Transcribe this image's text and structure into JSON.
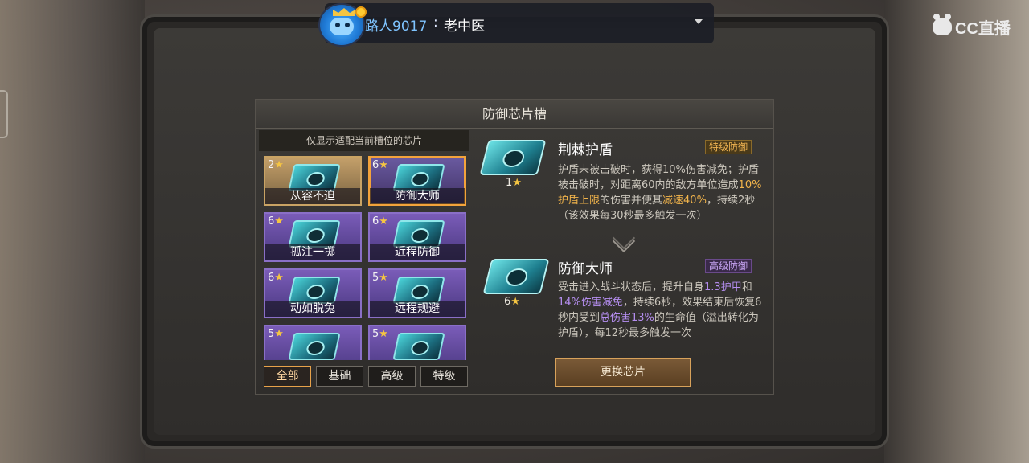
{
  "stream": {
    "user": "路人9017",
    "separator": ":",
    "title": "老中医"
  },
  "logo": {
    "text": "CC直播"
  },
  "dialog": {
    "title": "防御芯片槽",
    "filter_note": "仅显示适配当前槽位的芯片",
    "cards": [
      {
        "stars": "2",
        "name": "从容不迫",
        "rarity": "gold"
      },
      {
        "stars": "6",
        "name": "防御大师",
        "rarity": "purple",
        "selected": true
      },
      {
        "stars": "6",
        "name": "孤注一掷",
        "rarity": "purple"
      },
      {
        "stars": "6",
        "name": "近程防御",
        "rarity": "purple"
      },
      {
        "stars": "6",
        "name": "动如脱兔",
        "rarity": "purple"
      },
      {
        "stars": "5",
        "name": "远程规避",
        "rarity": "purple"
      },
      {
        "stars": "5",
        "name": "",
        "rarity": "purple"
      },
      {
        "stars": "5",
        "name": "",
        "rarity": "purple"
      }
    ],
    "star_glyph": "★",
    "tabs": [
      {
        "label": "全部",
        "active": true
      },
      {
        "label": "基础",
        "active": false
      },
      {
        "label": "高级",
        "active": false
      },
      {
        "label": "特级",
        "active": false
      }
    ],
    "current": {
      "stars": "1",
      "title": "荆棘护盾",
      "grade": "特级防御",
      "desc_parts": [
        {
          "t": "护盾未被击破时，获得10%伤害减免；护盾被击破时，对距离60内的敌方单位造成",
          "c": ""
        },
        {
          "t": "10%护盾上限",
          "c": "gold"
        },
        {
          "t": "的伤害并使其",
          "c": ""
        },
        {
          "t": "减速40%",
          "c": "gold"
        },
        {
          "t": "，持续2秒（该效果每30秒最多触发一次）",
          "c": ""
        }
      ]
    },
    "next": {
      "stars": "6",
      "title": "防御大师",
      "grade": "高级防御",
      "desc_parts": [
        {
          "t": "受击进入战斗状态后，提升自身",
          "c": ""
        },
        {
          "t": "1.3护甲",
          "c": "purple"
        },
        {
          "t": "和",
          "c": ""
        },
        {
          "t": "14%伤害减免",
          "c": "purple"
        },
        {
          "t": "，持续6秒，效果结束后恢复6秒内受到",
          "c": ""
        },
        {
          "t": "总伤害13%",
          "c": "purple"
        },
        {
          "t": "的生命值（溢出转化为护盾），每12秒最多触发一次",
          "c": ""
        }
      ]
    },
    "replace_button": "更换芯片"
  },
  "colors": {
    "gold_accent": "#f2b44b",
    "purple_accent": "#b58ef0",
    "selected_border": "#f3a33b",
    "stream_name": "#7fc4ff"
  }
}
